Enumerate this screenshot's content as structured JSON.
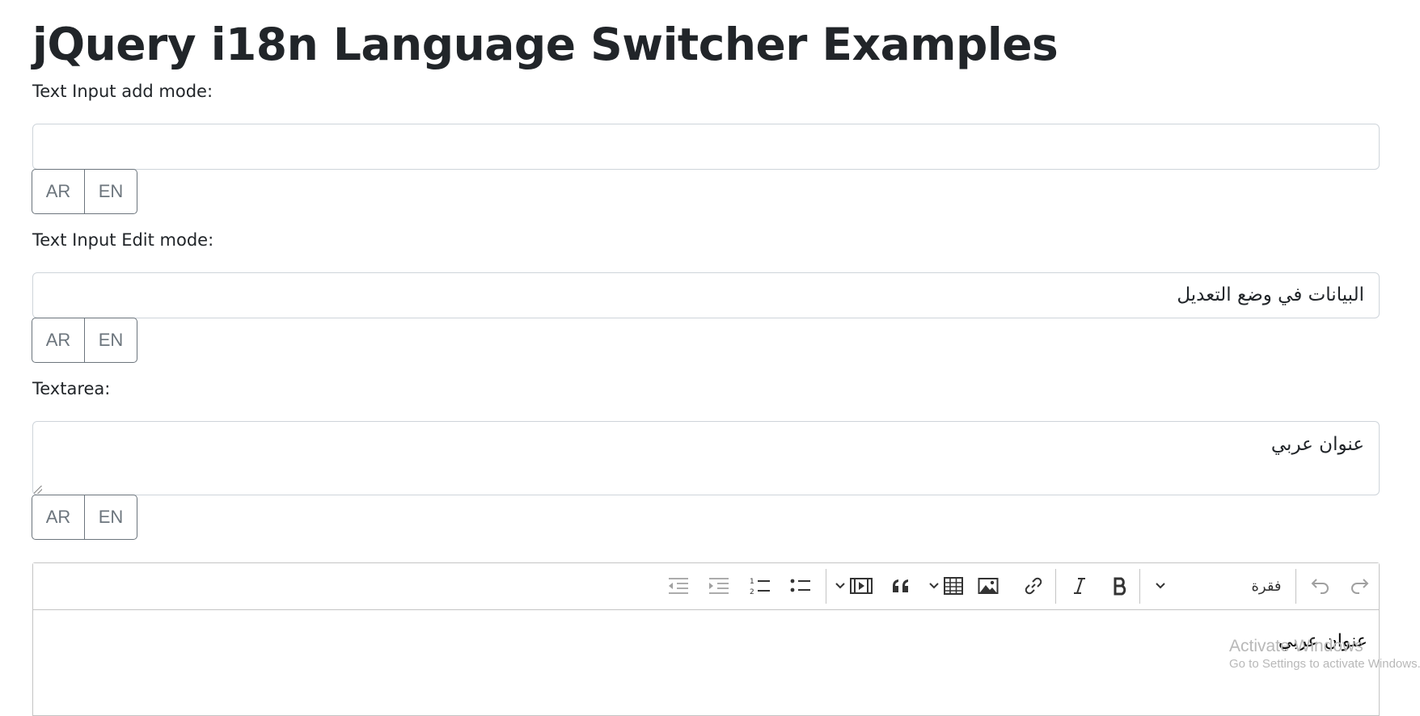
{
  "page": {
    "title": "jQuery i18n Language Switcher Examples"
  },
  "add_mode": {
    "label": "Text Input add mode:",
    "value": "",
    "buttons": [
      "AR",
      "EN"
    ]
  },
  "edit_mode": {
    "label": "Text Input Edit mode:",
    "value": "البيانات في وضع التعديل",
    "buttons": [
      "AR",
      "EN"
    ]
  },
  "textarea": {
    "label": "Textarea:",
    "value": "عنوان عربي",
    "buttons": [
      "AR",
      "EN"
    ]
  },
  "editor": {
    "heading_dropdown_label": "فقرة",
    "content": "عنوان عربي",
    "toolbar_icons": [
      "redo-icon",
      "undo-icon",
      "chevron-down-icon",
      "bold-icon",
      "italic-icon",
      "link-icon",
      "image-icon",
      "table-icon",
      "blockquote-icon",
      "media-embed-icon",
      "bulleted-list-icon",
      "numbered-list-icon",
      "indent-icon",
      "outdent-icon"
    ]
  },
  "watermark": {
    "line1": "Activate Windows",
    "line2": "Go to Settings to activate Windows."
  }
}
